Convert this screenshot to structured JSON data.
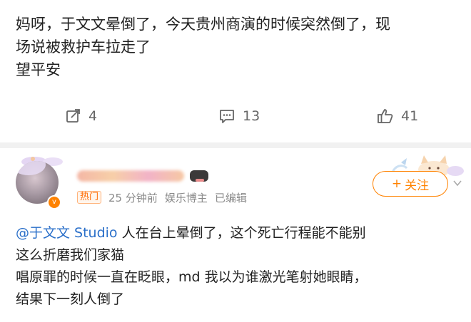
{
  "post": {
    "lines": [
      "妈呀，于文文晕倒了，今天贵州商演的时候突然倒了，现",
      "场说被救护车拉走了",
      "望平安"
    ],
    "repost_count": "4",
    "comment_count": "13",
    "like_count": "41"
  },
  "comment": {
    "hot_badge": "热门",
    "time": "25 分钟前",
    "user_role": "娱乐博主",
    "edited": "已编辑",
    "follow_label": "关注",
    "mention": "@于文文 Studio",
    "line1_rest": " 人在台上晕倒了，这个死亡行程能不能别",
    "line2": "这么折磨我们家猫",
    "line3": "唱原罪的时候一直在眨眼，md 我以为谁激光笔射她眼睛，",
    "line4": "结果下一刻人倒了"
  },
  "colors": {
    "accent": "#ff8200",
    "mention": "#2a6fc9",
    "meta": "#8a8a8a"
  }
}
